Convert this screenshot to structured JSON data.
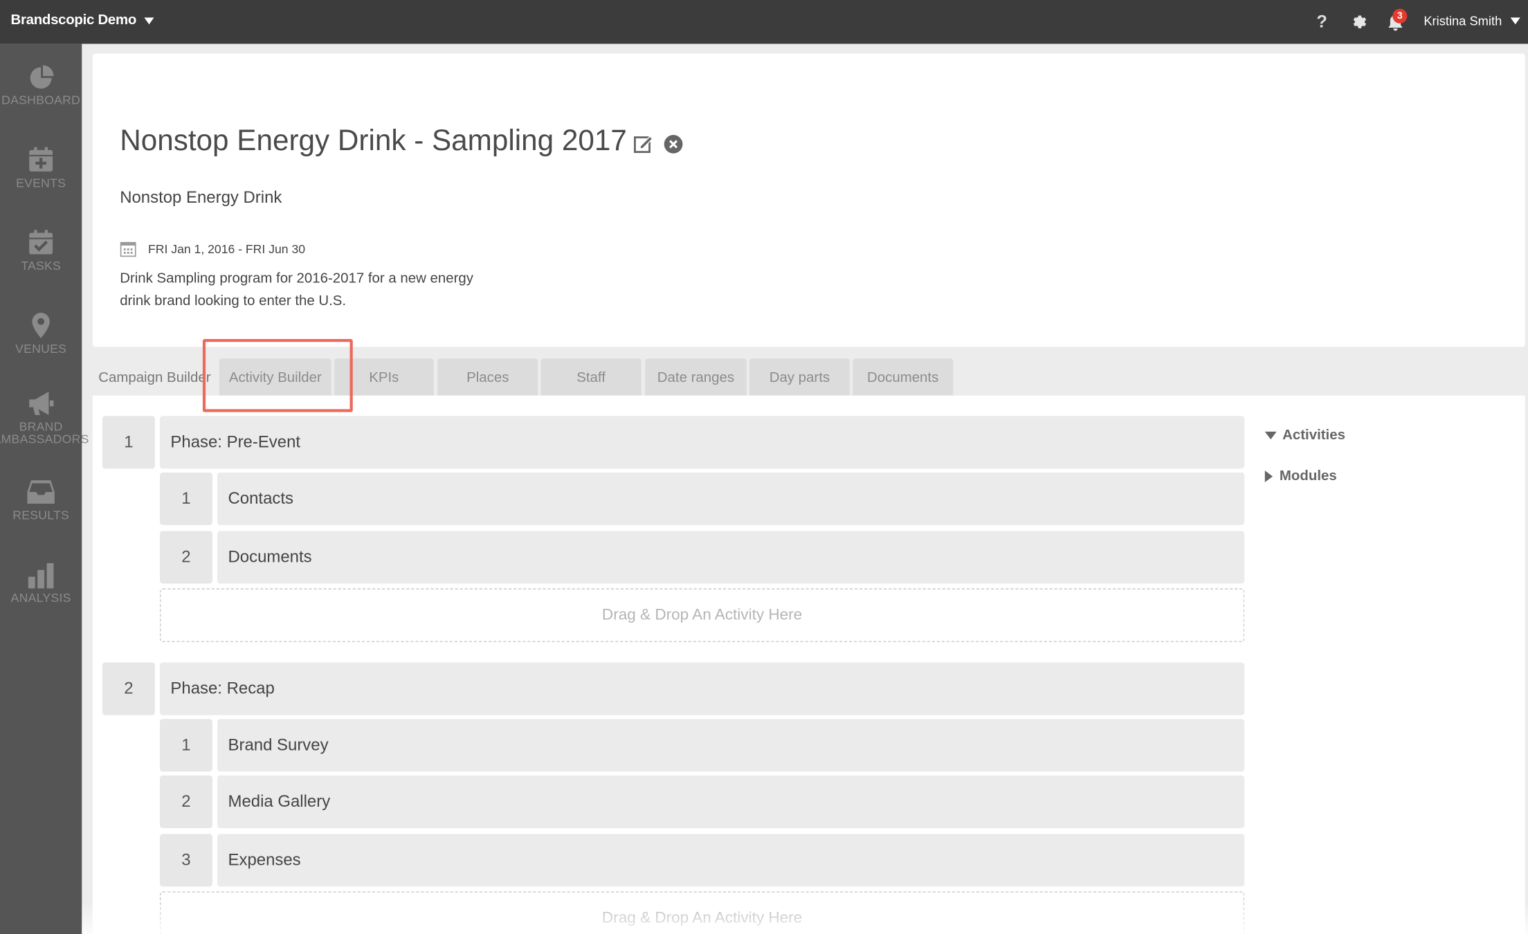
{
  "topbar": {
    "app_name": "Brandscopic Demo",
    "help_label": "?",
    "notification_count": "3",
    "user_name": "Kristina Smith"
  },
  "sidebar": {
    "items": [
      {
        "label": "DASHBOARD",
        "icon": "dashboard-icon"
      },
      {
        "label": "EVENTS",
        "icon": "calendar-plus-icon"
      },
      {
        "label": "TASKS",
        "icon": "calendar-check-icon"
      },
      {
        "label": "VENUES",
        "icon": "map-pin-icon"
      },
      {
        "label": "BRAND AMBASSADORS",
        "icon": "megaphone-icon"
      },
      {
        "label": "RESULTS",
        "icon": "inbox-icon"
      },
      {
        "label": "ANALYSIS",
        "icon": "bar-chart-icon"
      }
    ]
  },
  "campaign": {
    "title": "Nonstop Energy Drink - Sampling 2017",
    "brand": "Nonstop Energy Drink",
    "date_range": "FRI Jan 1, 2016 - FRI Jun 30",
    "description": "Drink Sampling program for 2016-2017 for a new energy drink brand looking to enter the U.S."
  },
  "tabs": [
    {
      "label": "Campaign Builder",
      "active": true
    },
    {
      "label": "Activity Builder",
      "active": false
    },
    {
      "label": "KPIs",
      "active": false
    },
    {
      "label": "Places",
      "active": false
    },
    {
      "label": "Staff",
      "active": false
    },
    {
      "label": "Date ranges",
      "active": false
    },
    {
      "label": "Day parts",
      "active": false
    },
    {
      "label": "Documents",
      "active": false
    }
  ],
  "phases": [
    {
      "number": "1",
      "title": "Phase: Pre-Event",
      "activities": [
        {
          "number": "1",
          "name": "Contacts"
        },
        {
          "number": "2",
          "name": "Documents"
        }
      ],
      "dropzone": "Drag & Drop An Activity Here"
    },
    {
      "number": "2",
      "title": "Phase: Recap",
      "activities": [
        {
          "number": "1",
          "name": "Brand Survey"
        },
        {
          "number": "2",
          "name": "Media Gallery"
        },
        {
          "number": "3",
          "name": "Expenses"
        }
      ],
      "dropzone": "Drag & Drop An Activity Here"
    }
  ],
  "tree": {
    "activities_label": "Activities",
    "modules_label": "Modules"
  },
  "colors": {
    "topbar": "#3c3c3c",
    "sidebar": "#555555",
    "highlight": "#ec6a5c",
    "badge": "#e33b2f"
  }
}
